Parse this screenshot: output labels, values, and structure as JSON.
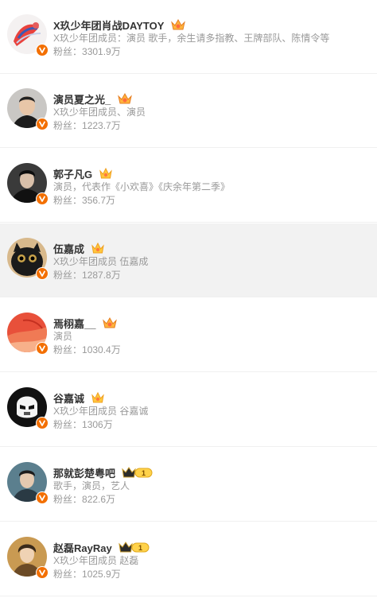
{
  "users": [
    {
      "name": "X玖少年团肖战DAYTOY",
      "badge": "crown-orange",
      "desc": "X玖少年团成员：演员 歌手，余生请多指教、王牌部队、陈情令等",
      "fans_label": "粉丝：",
      "fans": "3301.9万",
      "avatar": "red-art"
    },
    {
      "name": "演员夏之光_",
      "badge": "crown-orange",
      "desc": "X玖少年团成员、演员",
      "fans_label": "粉丝：",
      "fans": "1223.7万",
      "avatar": "man-dark-suit"
    },
    {
      "name": "郭子凡G",
      "badge": "crown-yellow",
      "desc": "演员，代表作《小欢喜》《庆余年第二季》",
      "fans_label": "粉丝：",
      "fans": "356.7万",
      "avatar": "man-black-shirt"
    },
    {
      "name": "伍嘉成",
      "badge": "crown-yellow",
      "desc": "X玖少年团成员 伍嘉成",
      "fans_label": "粉丝：",
      "fans": "1287.8万",
      "avatar": "black-cat"
    },
    {
      "name": "焉栩嘉__",
      "badge": "crown-orange",
      "desc": "演员",
      "fans_label": "粉丝：",
      "fans": "1030.4万",
      "avatar": "red-painting"
    },
    {
      "name": "谷嘉诚",
      "badge": "crown-yellow",
      "desc": "X玖少年团成员 谷嘉诚",
      "fans_label": "粉丝：",
      "fans": "1306万",
      "avatar": "stormtrooper"
    },
    {
      "name": "那就彭楚粤吧",
      "badge": "level-crown",
      "badge_text": "1",
      "desc": "歌手，演员，艺人",
      "fans_label": "粉丝：",
      "fans": "822.6万",
      "avatar": "man-teal"
    },
    {
      "name": "赵磊RayRay",
      "badge": "level-crown",
      "badge_text": "1",
      "desc": "X玖少年团成员 赵磊",
      "fans_label": "粉丝：",
      "fans": "1025.9万",
      "avatar": "man-golden"
    }
  ],
  "colors": {
    "verified": "#f36f00",
    "name": "#333333",
    "meta": "#999999",
    "hover_bg": "#f2f2f2"
  }
}
